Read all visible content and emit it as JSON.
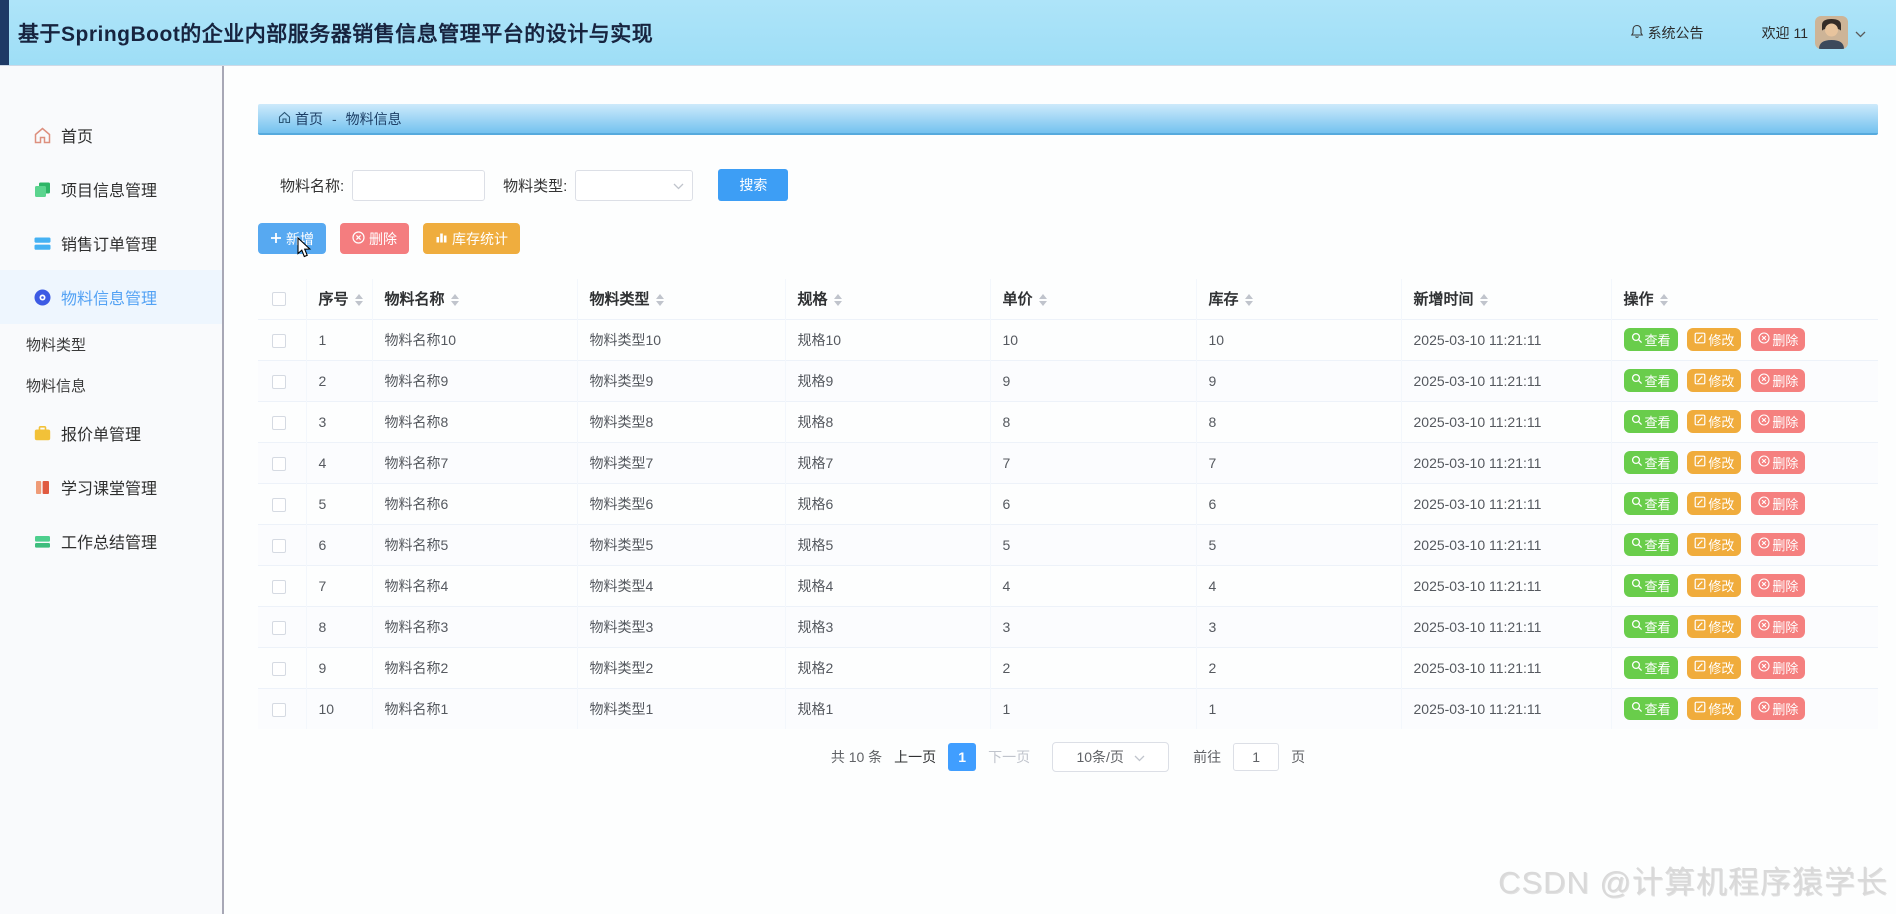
{
  "header": {
    "title": "基于SpringBoot的企业内部服务器销售信息管理平台的设计与实现",
    "notice": "系统公告",
    "welcome": "欢迎 11"
  },
  "sidebar": {
    "items": [
      {
        "label": "首页",
        "icon": "home-icon"
      },
      {
        "label": "项目信息管理",
        "icon": "project-icon"
      },
      {
        "label": "销售订单管理",
        "icon": "sales-order-icon"
      },
      {
        "label": "物料信息管理",
        "icon": "material-icon",
        "active": true
      },
      {
        "label": "物料类型",
        "submenu": true
      },
      {
        "label": "物料信息",
        "submenu": true
      },
      {
        "label": "报价单管理",
        "icon": "quotation-icon"
      },
      {
        "label": "学习课堂管理",
        "icon": "learning-icon"
      },
      {
        "label": "工作总结管理",
        "icon": "summary-icon"
      }
    ]
  },
  "breadcrumb": {
    "home": "首页",
    "separator": "-",
    "current": "物料信息"
  },
  "search": {
    "name_label": "物料名称:",
    "name_value": "",
    "type_label": "物料类型:",
    "type_value": "",
    "submit": "搜索"
  },
  "toolbar": {
    "add": "新增",
    "delete": "删除",
    "stock": "库存统计"
  },
  "table": {
    "headers": [
      "序号",
      "物料名称",
      "物料类型",
      "规格",
      "单价",
      "库存",
      "新增时间",
      "操作"
    ],
    "actions": {
      "view": "查看",
      "edit": "修改",
      "delete": "删除"
    },
    "rows": [
      {
        "no": "1",
        "name": "物料名称10",
        "type": "物料类型10",
        "spec": "规格10",
        "price": "10",
        "stock": "10",
        "time": "2025-03-10 11:21:11"
      },
      {
        "no": "2",
        "name": "物料名称9",
        "type": "物料类型9",
        "spec": "规格9",
        "price": "9",
        "stock": "9",
        "time": "2025-03-10 11:21:11"
      },
      {
        "no": "3",
        "name": "物料名称8",
        "type": "物料类型8",
        "spec": "规格8",
        "price": "8",
        "stock": "8",
        "time": "2025-03-10 11:21:11"
      },
      {
        "no": "4",
        "name": "物料名称7",
        "type": "物料类型7",
        "spec": "规格7",
        "price": "7",
        "stock": "7",
        "time": "2025-03-10 11:21:11"
      },
      {
        "no": "5",
        "name": "物料名称6",
        "type": "物料类型6",
        "spec": "规格6",
        "price": "6",
        "stock": "6",
        "time": "2025-03-10 11:21:11"
      },
      {
        "no": "6",
        "name": "物料名称5",
        "type": "物料类型5",
        "spec": "规格5",
        "price": "5",
        "stock": "5",
        "time": "2025-03-10 11:21:11"
      },
      {
        "no": "7",
        "name": "物料名称4",
        "type": "物料类型4",
        "spec": "规格4",
        "price": "4",
        "stock": "4",
        "time": "2025-03-10 11:21:11"
      },
      {
        "no": "8",
        "name": "物料名称3",
        "type": "物料类型3",
        "spec": "规格3",
        "price": "3",
        "stock": "3",
        "time": "2025-03-10 11:21:11"
      },
      {
        "no": "9",
        "name": "物料名称2",
        "type": "物料类型2",
        "spec": "规格2",
        "price": "2",
        "stock": "2",
        "time": "2025-03-10 11:21:11"
      },
      {
        "no": "10",
        "name": "物料名称1",
        "type": "物料类型1",
        "spec": "规格1",
        "price": "1",
        "stock": "1",
        "time": "2025-03-10 11:21:11"
      }
    ]
  },
  "pagination": {
    "total": "共 10 条",
    "prev": "上一页",
    "page": "1",
    "next": "下一页",
    "size": "10条/页",
    "goto_label": "前往",
    "goto_value": "1",
    "goto_unit": "页"
  },
  "watermark": "CSDN @计算机程序猿学长",
  "colors": {
    "header_bg": "#a5e0f8",
    "header_strip": "#1e3a66",
    "accent": "#409eff",
    "add_button": "#57a9f1",
    "danger_button": "#f47d7f",
    "warning_button": "#efad3e",
    "view_button": "#69cd4b",
    "active_menu": "#53a2f4",
    "crumb_bar": "#74c2ef"
  }
}
